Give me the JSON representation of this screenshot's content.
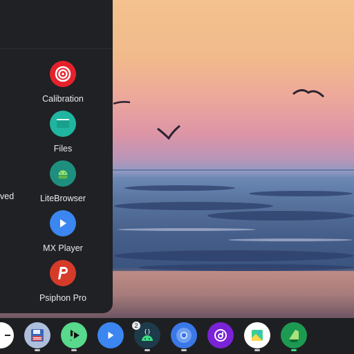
{
  "drawer": {
    "partial_label": "ved",
    "apps": [
      {
        "label": "Calibration",
        "icon": "target-icon",
        "color": "#e5222b"
      },
      {
        "label": "Files",
        "icon": "folder-icon",
        "color": "#1fb5a0"
      },
      {
        "label": "LiteBrowser",
        "icon": "android-icon",
        "color": "#1e8f7e"
      },
      {
        "label": "MX Player",
        "icon": "play-icon",
        "color": "#3b86f0"
      },
      {
        "label": "Psiphon Pro",
        "icon": "psiphon-icon",
        "color": "#d63b2a"
      }
    ]
  },
  "shelf": {
    "items": [
      {
        "name": "partial-app-icon",
        "color": "#ffffff"
      },
      {
        "name": "save-disk-icon",
        "color": "#aebfdc"
      },
      {
        "name": "music-player-icon",
        "color": "#58d98b"
      },
      {
        "name": "video-play-icon",
        "color": "#3b86f0"
      },
      {
        "name": "android-code-icon",
        "color": "#1d3b4a",
        "badge": "2"
      },
      {
        "name": "chrome-browser-icon",
        "color": "#3b78e7"
      },
      {
        "name": "purple-app-icon",
        "color": "#7a22d6"
      },
      {
        "name": "gallery-icon",
        "color": "#ffffff"
      },
      {
        "name": "snapseed-icon",
        "color": "#1c9a52"
      }
    ],
    "code_glyph": "{}"
  }
}
